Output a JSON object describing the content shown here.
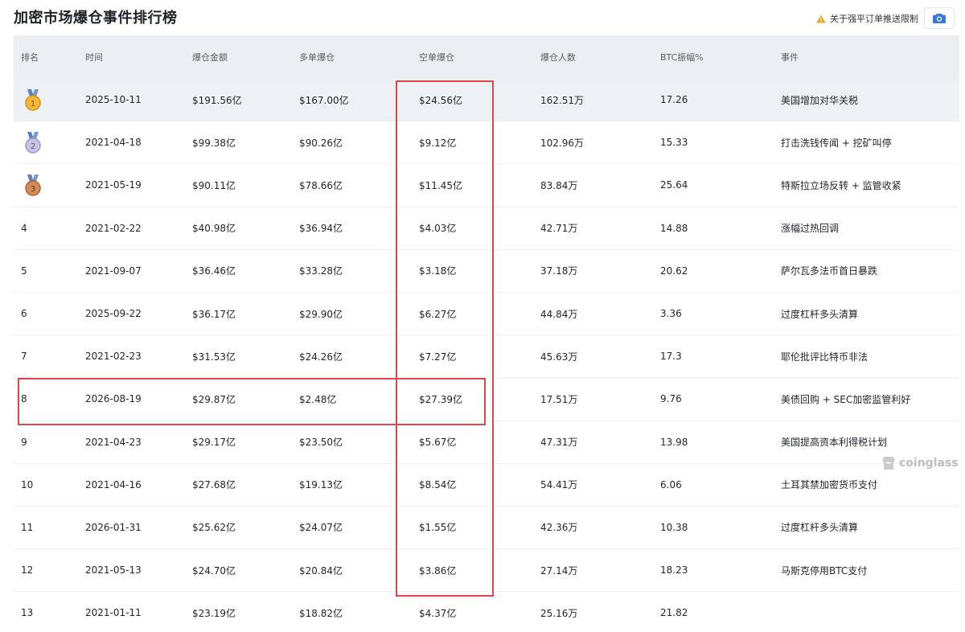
{
  "header": {
    "title": "加密市场爆仓事件排行榜",
    "notice_text": "关于强平订单推送限制",
    "colors": {
      "warning": "#f0a020",
      "camera_icon": "#3a7bd5"
    }
  },
  "table": {
    "columns": [
      "排名",
      "时间",
      "爆仓金额",
      "多单爆仓",
      "空单爆仓",
      "爆仓人数",
      "BTC振幅%",
      "事件"
    ],
    "rows": [
      {
        "rank": "1",
        "medal": "gold",
        "date": "2025-10-11",
        "total": "$191.56亿",
        "long": "$167.00亿",
        "short": "$24.56亿",
        "people": "162.51万",
        "btc": "17.26",
        "event": "美国增加对华关税"
      },
      {
        "rank": "2",
        "medal": "silver",
        "date": "2021-04-18",
        "total": "$99.38亿",
        "long": "$90.26亿",
        "short": "$9.12亿",
        "people": "102.96万",
        "btc": "15.33",
        "event": "打击洗钱传闻 + 挖矿叫停"
      },
      {
        "rank": "3",
        "medal": "bronze",
        "date": "2021-05-19",
        "total": "$90.11亿",
        "long": "$78.66亿",
        "short": "$11.45亿",
        "people": "83.84万",
        "btc": "25.64",
        "event": "特斯拉立场反转 + 监管收紧"
      },
      {
        "rank": "4",
        "medal": "",
        "date": "2021-02-22",
        "total": "$40.98亿",
        "long": "$36.94亿",
        "short": "$4.03亿",
        "people": "42.71万",
        "btc": "14.88",
        "event": "涨幅过热回调"
      },
      {
        "rank": "5",
        "medal": "",
        "date": "2021-09-07",
        "total": "$36.46亿",
        "long": "$33.28亿",
        "short": "$3.18亿",
        "people": "37.18万",
        "btc": "20.62",
        "event": "萨尔瓦多法币首日暴跌"
      },
      {
        "rank": "6",
        "medal": "",
        "date": "2025-09-22",
        "total": "$36.17亿",
        "long": "$29.90亿",
        "short": "$6.27亿",
        "people": "44.84万",
        "btc": "3.36",
        "event": "过度杠杆多头清算"
      },
      {
        "rank": "7",
        "medal": "",
        "date": "2021-02-23",
        "total": "$31.53亿",
        "long": "$24.26亿",
        "short": "$7.27亿",
        "people": "45.63万",
        "btc": "17.3",
        "event": "耶伦批评比特币非法"
      },
      {
        "rank": "8",
        "medal": "",
        "date": "2026-08-19",
        "total": "$29.87亿",
        "long": "$2.48亿",
        "short": "$27.39亿",
        "people": "17.51万",
        "btc": "9.76",
        "event": "美债回购 + SEC加密监管利好"
      },
      {
        "rank": "9",
        "medal": "",
        "date": "2021-04-23",
        "total": "$29.17亿",
        "long": "$23.50亿",
        "short": "$5.67亿",
        "people": "47.31万",
        "btc": "13.98",
        "event": "美国提高资本利得税计划"
      },
      {
        "rank": "10",
        "medal": "",
        "date": "2021-04-16",
        "total": "$27.68亿",
        "long": "$19.13亿",
        "short": "$8.54亿",
        "people": "54.41万",
        "btc": "6.06",
        "event": "土耳其禁加密货币支付"
      },
      {
        "rank": "11",
        "medal": "",
        "date": "2026-01-31",
        "total": "$25.62亿",
        "long": "$24.07亿",
        "short": "$1.55亿",
        "people": "42.36万",
        "btc": "10.38",
        "event": "过度杠杆多头清算"
      },
      {
        "rank": "12",
        "medal": "",
        "date": "2021-05-13",
        "total": "$24.70亿",
        "long": "$20.84亿",
        "short": "$3.86亿",
        "people": "27.14万",
        "btc": "18.23",
        "event": "马斯克停用BTC支付"
      },
      {
        "rank": "13",
        "medal": "",
        "date": "2021-01-11",
        "total": "$23.19亿",
        "long": "$18.82亿",
        "short": "$4.37亿",
        "people": "25.16万",
        "btc": "21.82",
        "event": ""
      }
    ]
  },
  "watermark": {
    "text": "coinglass"
  },
  "annotations": {
    "color": "#e0474c"
  }
}
